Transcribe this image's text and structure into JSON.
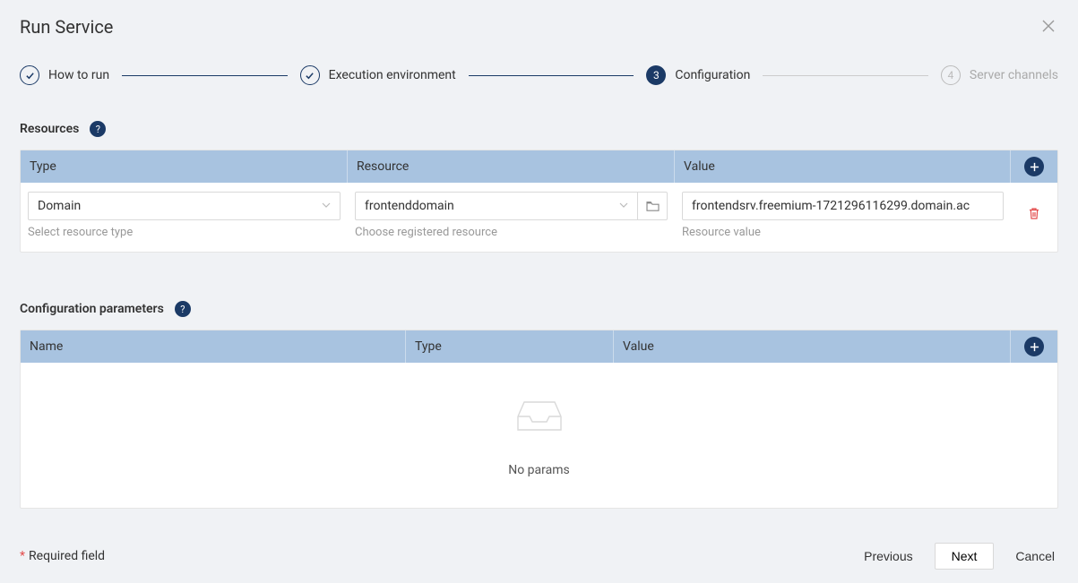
{
  "modalTitle": "Run Service",
  "steps": [
    {
      "label": "How to run",
      "state": "done"
    },
    {
      "label": "Execution environment",
      "state": "done"
    },
    {
      "label": "Configuration",
      "state": "active",
      "num": "3"
    },
    {
      "label": "Server channels",
      "state": "pending",
      "num": "4"
    }
  ],
  "resources": {
    "heading": "Resources",
    "columns": {
      "type": "Type",
      "resource": "Resource",
      "value": "Value"
    },
    "row": {
      "type": "Domain",
      "typeHint": "Select resource type",
      "resource": "frontenddomain",
      "resourceHint": "Choose registered resource",
      "value": "frontendsrv.freemium-1721296116299.domain.ac",
      "valueHint": "Resource value"
    }
  },
  "params": {
    "heading": "Configuration parameters",
    "columns": {
      "name": "Name",
      "type": "Type",
      "value": "Value"
    },
    "emptyText": "No params"
  },
  "footer": {
    "required": "Required field",
    "prev": "Previous",
    "next": "Next",
    "cancel": "Cancel"
  }
}
